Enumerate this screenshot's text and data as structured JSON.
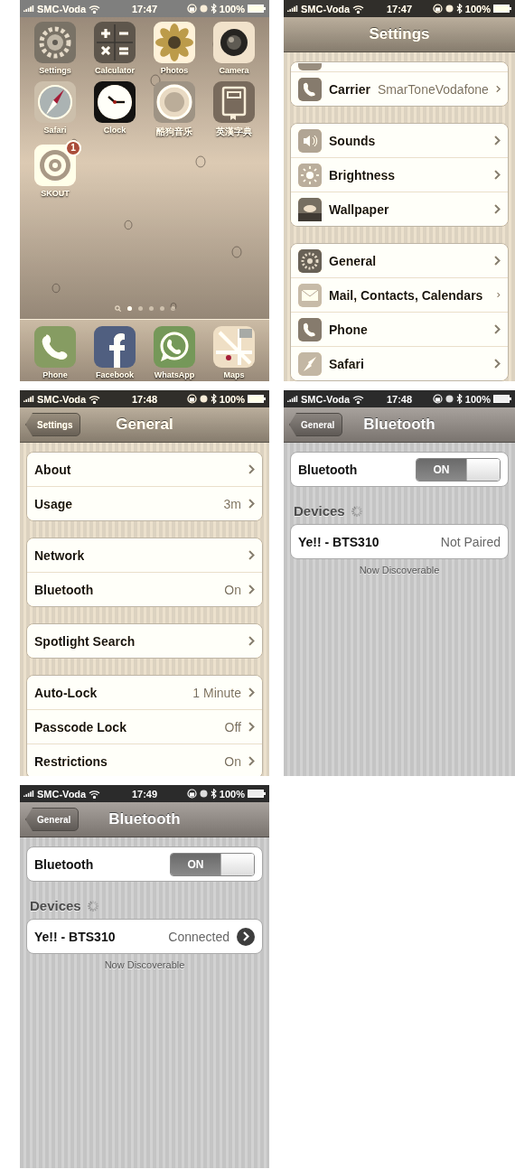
{
  "screens": [
    {
      "kind": "home",
      "status": {
        "carrier": "SMC-Voda",
        "time": "17:47",
        "battery": "100%"
      },
      "apps": [
        {
          "label": "Settings"
        },
        {
          "label": "Calculator"
        },
        {
          "label": "Photos"
        },
        {
          "label": "Camera"
        },
        {
          "label": "Safari"
        },
        {
          "label": "Clock"
        },
        {
          "label": "酷狗音乐"
        },
        {
          "label": "英漢字典"
        },
        {
          "label": "SKOUT",
          "badge": "1"
        }
      ],
      "pages": [
        {
          "selected": true
        },
        {
          "selected": false
        },
        {
          "selected": false
        },
        {
          "selected": false
        },
        {
          "selected": false
        }
      ],
      "dock": [
        {
          "label": "Phone"
        },
        {
          "label": "Facebook"
        },
        {
          "label": "WhatsApp"
        },
        {
          "label": "Maps"
        }
      ]
    },
    {
      "kind": "list",
      "status": {
        "carrier": "SMC-Voda",
        "time": "17:47",
        "battery": "100%"
      },
      "nav": {
        "title": "Settings"
      },
      "groups": [
        {
          "rows": [
            {
              "kind": "stub"
            },
            {
              "kind": "link",
              "label": "Carrier",
              "value": "SmarToneVodafone"
            }
          ]
        },
        {
          "rows": [
            {
              "kind": "link",
              "label": "Sounds"
            },
            {
              "kind": "link",
              "label": "Brightness"
            },
            {
              "kind": "link",
              "label": "Wallpaper"
            }
          ]
        },
        {
          "rows": [
            {
              "kind": "link",
              "label": "General"
            },
            {
              "kind": "link",
              "label": "Mail, Contacts, Calendars"
            },
            {
              "kind": "link",
              "label": "Phone"
            },
            {
              "kind": "link",
              "label": "Safari"
            }
          ]
        }
      ]
    },
    {
      "kind": "list",
      "status": {
        "carrier": "SMC-Voda",
        "time": "17:48",
        "battery": "100%"
      },
      "nav": {
        "title": "General",
        "back": "Settings"
      },
      "groups": [
        {
          "rows": [
            {
              "kind": "link",
              "label": "About"
            },
            {
              "kind": "link",
              "label": "Usage",
              "value": "3m"
            }
          ]
        },
        {
          "rows": [
            {
              "kind": "link",
              "label": "Network"
            },
            {
              "kind": "link",
              "label": "Bluetooth",
              "value": "On"
            }
          ]
        },
        {
          "rows": [
            {
              "kind": "link",
              "label": "Spotlight Search"
            }
          ]
        },
        {
          "rows": [
            {
              "kind": "link",
              "label": "Auto-Lock",
              "value": "1 Minute"
            },
            {
              "kind": "link",
              "label": "Passcode Lock",
              "value": "Off"
            },
            {
              "kind": "link",
              "label": "Restrictions",
              "value": "On"
            }
          ]
        }
      ]
    },
    {
      "kind": "list",
      "status": {
        "carrier": "SMC-Voda",
        "time": "17:48",
        "battery": "100%"
      },
      "nav": {
        "title": "Bluetooth",
        "back": "General"
      },
      "groups": [
        {
          "rows": [
            {
              "kind": "switch",
              "label": "Bluetooth",
              "on": true,
              "on_text": "ON"
            }
          ]
        },
        {
          "header": "Devices",
          "loading": true,
          "rows": [
            {
              "kind": "status",
              "label": "Ye!! - BTS310",
              "value": "Not Paired"
            }
          ],
          "footer": "Now Discoverable"
        }
      ]
    },
    {
      "kind": "list",
      "status": {
        "carrier": "SMC-Voda",
        "time": "17:49",
        "battery": "100%"
      },
      "nav": {
        "title": "Bluetooth",
        "back": "General"
      },
      "groups": [
        {
          "rows": [
            {
              "kind": "switch",
              "label": "Bluetooth",
              "on": true,
              "on_text": "ON"
            }
          ]
        },
        {
          "header": "Devices",
          "loading": true,
          "rows": [
            {
              "kind": "detail",
              "label": "Ye!! - BTS310",
              "value": "Connected"
            }
          ],
          "footer": "Now Discoverable"
        }
      ]
    }
  ]
}
